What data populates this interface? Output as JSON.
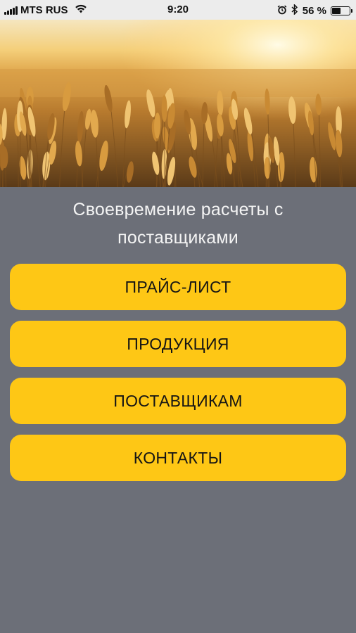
{
  "status_bar": {
    "carrier": "MTS RUS",
    "time": "9:20",
    "battery_percent": "56 %",
    "battery_level": 0.56,
    "icons": [
      "signal-icon",
      "wifi-icon",
      "alarm-icon",
      "bluetooth-icon",
      "battery-icon"
    ]
  },
  "hero": {
    "icon": "wheat-field-image"
  },
  "tagline": "Своевремение расчеты с поставщиками",
  "menu": {
    "items": [
      {
        "label": "ПРАЙС-ЛИСТ"
      },
      {
        "label": "ПРОДУКЦИЯ"
      },
      {
        "label": "ПОСТАВЩИКАМ"
      },
      {
        "label": "КОНТАКТЫ"
      }
    ]
  },
  "colors": {
    "background": "#6c6f78",
    "button": "#fec715",
    "button_text": "#151515",
    "tagline_text": "#f4f4f4"
  }
}
